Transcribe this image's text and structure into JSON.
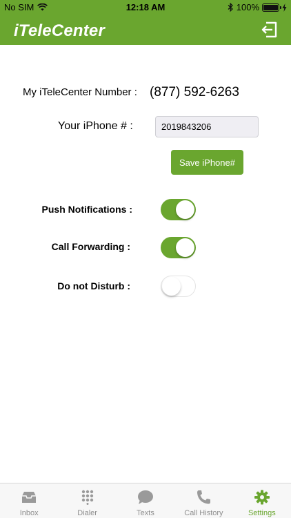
{
  "status_bar": {
    "carrier": "No SIM",
    "time": "12:18 AM",
    "battery": "100%"
  },
  "header": {
    "logo": "iTeleCenter",
    "logout_icon": "logout-icon"
  },
  "settings": {
    "number_label": "My iTeleCenter Number :",
    "number_value": "(877) 592-6263",
    "phone_label": "Your iPhone # :",
    "phone_value": "2019843206",
    "save_button": "Save iPhone#",
    "push_label": "Push Notifications :",
    "push_on": true,
    "call_forwarding_label": "Call Forwarding :",
    "call_forwarding_on": true,
    "dnd_label": "Do not Disturb :",
    "dnd_on": false
  },
  "tabs": [
    {
      "label": "Inbox",
      "icon": "inbox-icon",
      "active": false
    },
    {
      "label": "Dialer",
      "icon": "dialpad-icon",
      "active": false
    },
    {
      "label": "Texts",
      "icon": "chat-bubble-icon",
      "active": false
    },
    {
      "label": "Call History",
      "icon": "phone-icon",
      "active": false
    },
    {
      "label": "Settings",
      "icon": "gear-icon",
      "active": true
    }
  ],
  "colors": {
    "accent": "#6aa62f",
    "inactive_tab": "#8e8e8e",
    "input_bg": "#efeef3"
  }
}
